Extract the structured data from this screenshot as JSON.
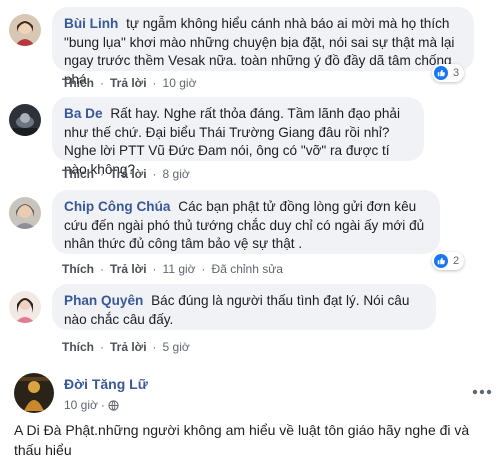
{
  "comments": [
    {
      "author": "Bùi Linh",
      "text": "tự ngẫm không hiểu cánh nhà báo ai mời mà họ thích \"bung lụa\" khơi mào những chuyện bịa đặt, nói sai sự thật mà lại ngay trước thềm Vesak nữa. toàn những ý đồ đầy dã tâm chống phá",
      "like_label": "Thích",
      "reply_label": "Trả lời",
      "time": "10 giờ",
      "reactions": "3",
      "avatar_icon": "user-avatar"
    },
    {
      "author": "Ba De",
      "text": "Rất hay. Nghe rất thỏa đáng. Tầm lãnh đạo phải như thế chứ. Đại biểu Thái Trường Giang đâu rồi nhỉ? Nghe lời PTT Vũ Đức Đam nói, ông có \"vỡ\" ra được tí nào không?",
      "like_label": "Thích",
      "reply_label": "Trả lời",
      "time": "8 giờ",
      "avatar_icon": "user-avatar"
    },
    {
      "author": "Chip Công Chúa",
      "text": "Các bạn phật tử đồng lòng gửi đơn kêu cứu đến ngài phó thủ tướng chắc duy chỉ có ngài ấy mới đủ nhân thức đủ công tâm bảo vệ sự thật .",
      "like_label": "Thích",
      "reply_label": "Trả lời",
      "time": "11 giờ",
      "edited": "Đã chỉnh sửa",
      "reactions": "2",
      "avatar_icon": "user-avatar"
    },
    {
      "author": "Phan Quyên",
      "text": "Bác đúng là người thấu tình đạt lý. Nói câu nào chắc câu đấy.",
      "like_label": "Thích",
      "reply_label": "Trả lời",
      "time": "5 giờ",
      "avatar_icon": "user-avatar"
    }
  ],
  "post": {
    "author": "Đời Tăng Lữ",
    "time": "10 giờ",
    "privacy_icon": "globe-icon",
    "body": "A Di Đà Phật.những người không am hiểu về luật tôn giáo hãy nghe đi và thấu hiểu",
    "more_icon": "more-icon"
  },
  "colors": {
    "link": "#385898",
    "bubble": "#f0f2f5",
    "like_blue": "#1877f2"
  }
}
